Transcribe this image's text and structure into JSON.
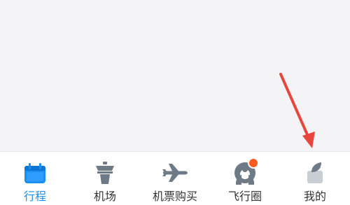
{
  "tabbar": {
    "tabs": [
      {
        "label": "行程",
        "icon": "calendar-icon",
        "active": true
      },
      {
        "label": "机场",
        "icon": "control-tower-icon",
        "active": false
      },
      {
        "label": "机票购买",
        "icon": "airplane-icon",
        "active": false
      },
      {
        "label": "飞行圈",
        "icon": "friends-circle-icon",
        "active": false,
        "has_badge": true
      },
      {
        "label": "我的",
        "icon": "profile-icon",
        "active": false
      }
    ]
  },
  "colors": {
    "accent": "#1a8ef5",
    "icon_inactive": "#6e7a86",
    "badge": "#ff5a1f",
    "annotation_arrow": "#e8453c"
  }
}
